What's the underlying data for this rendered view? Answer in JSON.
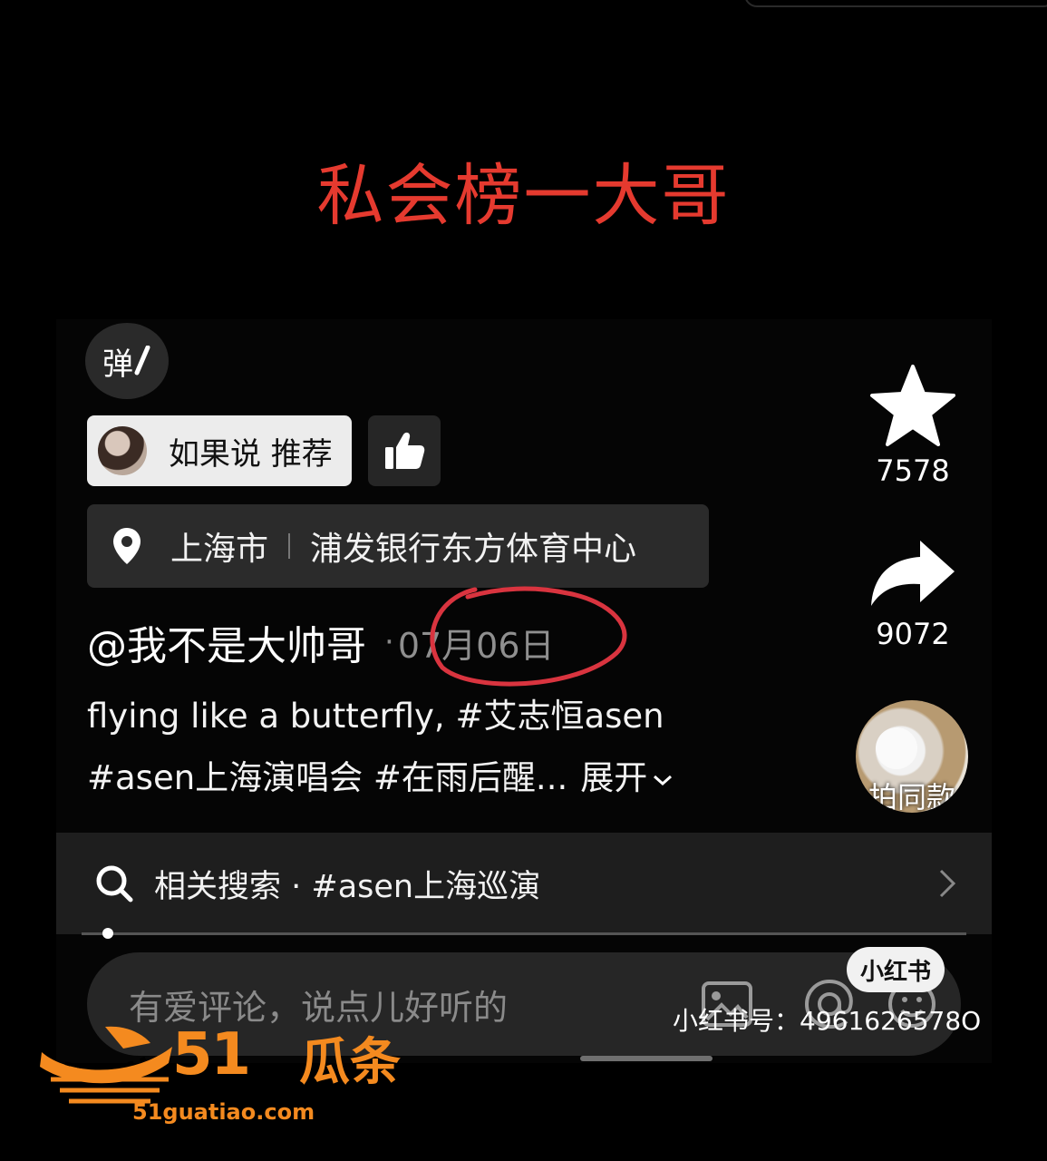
{
  "headline": "私会榜一大哥",
  "danmu_label": "弹",
  "recommend": {
    "label": "如果说 推荐"
  },
  "location": {
    "city": "上海市",
    "place": "浦发银行东方体育中心"
  },
  "post": {
    "author": "@我不是大帅哥",
    "date_sep": "·",
    "date": "07月06日",
    "desc_line1": "flying like a butterfly, #艾志恒asen",
    "desc_line2": "#asen上海演唱会 #在雨后醒...",
    "expand_label": "展开"
  },
  "actions": {
    "favorite_count": "7578",
    "share_count": "9072",
    "same_style_label": "拍同款"
  },
  "related_search": {
    "text": "相关搜索 · #asen上海巡演"
  },
  "comment": {
    "placeholder": "有爱评论，说点儿好听的"
  },
  "watermark": {
    "platform": "小红书",
    "platform_id": "小红书号：4961626578O",
    "site_number": "51",
    "site_name": "瓜条",
    "site_url": "51guatiao.com"
  },
  "colors": {
    "headline": "#e53a2f",
    "annotation_circle": "#d9343f",
    "brand": "#f48a1f"
  },
  "progress": 0.03
}
